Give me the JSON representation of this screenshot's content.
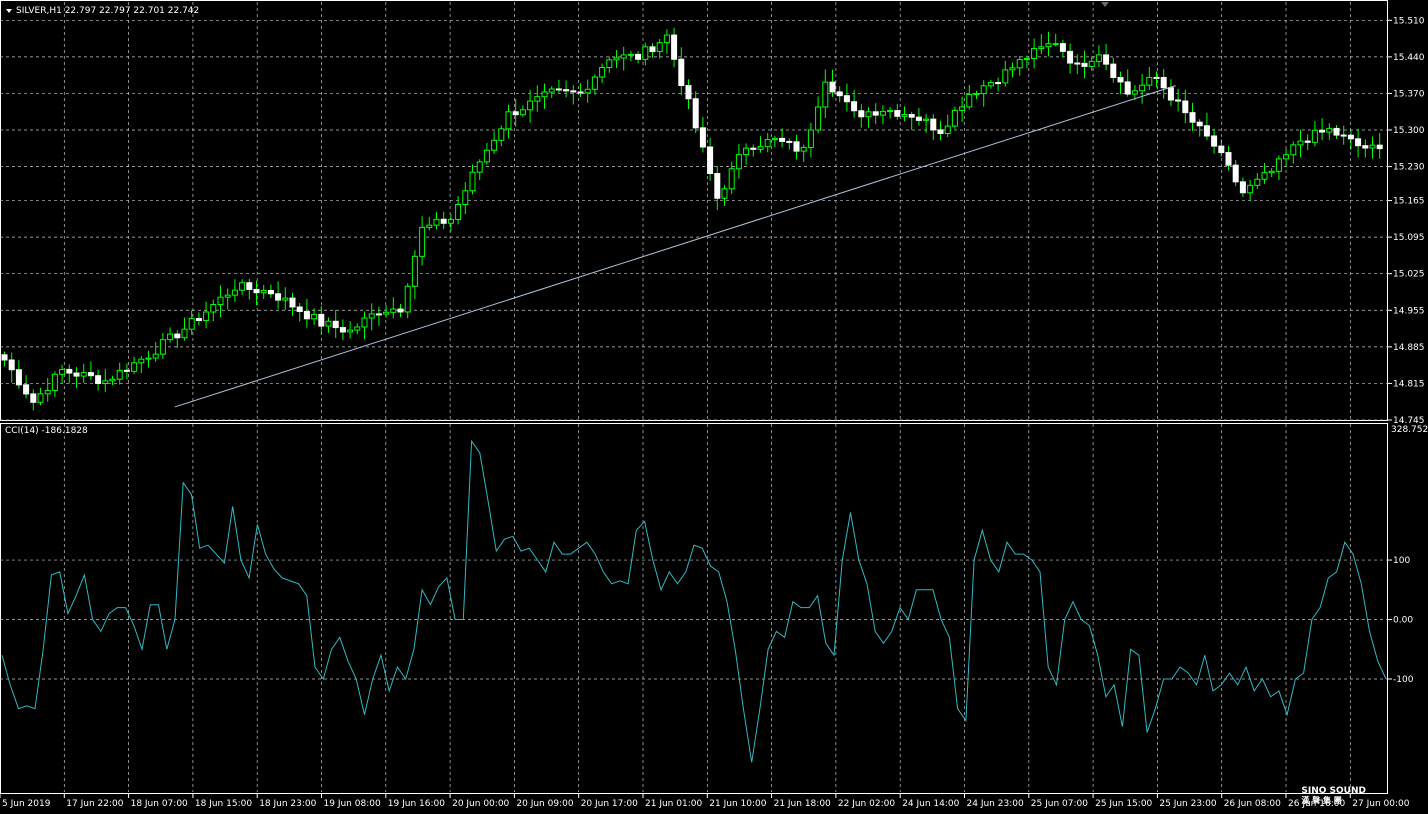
{
  "colors": {
    "background": "#000000",
    "grid": "#c8c8c8",
    "bull": "#00ff00",
    "bear": "#ffffff",
    "trendline": "#b0c4de",
    "cci_line": "#2fb9c4",
    "text": "#ffffff"
  },
  "price_panel": {
    "symbol_info": "SILVER,H1  22.797 22.797 22.701 22.742"
  },
  "indicator_panel": {
    "info": "CCI(14) -186.1828",
    "top_label": "328.7524"
  },
  "logo": {
    "line1": "SINO SOUND",
    "line2": "漢 聲 集 團"
  },
  "chart_data": [
    {
      "type": "candlestick",
      "title": "SILVER,H1",
      "y_ticks": [
        "15.510",
        "15.440",
        "15.370",
        "15.300",
        "15.230",
        "15.165",
        "15.095",
        "15.025",
        "14.955",
        "14.885",
        "14.815",
        "14.745"
      ],
      "ylim": [
        14.745,
        15.545
      ],
      "x_tick_labels": [
        "5 Jun 2019",
        "17 Jun 22:00",
        "18 Jun 07:00",
        "18 Jun 15:00",
        "18 Jun 23:00",
        "19 Jun 08:00",
        "19 Jun 16:00",
        "20 Jun 00:00",
        "20 Jun 09:00",
        "20 Jun 17:00",
        "21 Jun 01:00",
        "21 Jun 10:00",
        "21 Jun 18:00",
        "22 Jun 02:00",
        "24 Jun 14:00",
        "24 Jun 23:00",
        "25 Jun 07:00",
        "25 Jun 15:00",
        "25 Jun 23:00",
        "26 Jun 08:00",
        "26 Jun 16:00",
        "27 Jun 00:00"
      ],
      "close_anchors": [
        [
          0,
          14.86
        ],
        [
          4,
          14.78
        ],
        [
          8,
          14.84
        ],
        [
          14,
          14.82
        ],
        [
          20,
          14.87
        ],
        [
          26,
          14.93
        ],
        [
          32,
          15.0
        ],
        [
          37,
          14.99
        ],
        [
          44,
          14.93
        ],
        [
          48,
          14.915
        ],
        [
          52,
          14.955
        ],
        [
          55,
          14.96
        ],
        [
          58,
          15.11
        ],
        [
          62,
          15.13
        ],
        [
          66,
          15.24
        ],
        [
          70,
          15.33
        ],
        [
          76,
          15.37
        ],
        [
          80,
          15.37
        ],
        [
          84,
          15.44
        ],
        [
          88,
          15.44
        ],
        [
          92,
          15.48
        ],
        [
          95,
          15.35
        ],
        [
          99,
          15.17
        ],
        [
          103,
          15.27
        ],
        [
          107,
          15.28
        ],
        [
          111,
          15.26
        ],
        [
          114,
          15.4
        ],
        [
          118,
          15.33
        ],
        [
          122,
          15.34
        ],
        [
          126,
          15.33
        ],
        [
          130,
          15.3
        ],
        [
          134,
          15.37
        ],
        [
          138,
          15.4
        ],
        [
          142,
          15.44
        ],
        [
          146,
          15.47
        ],
        [
          149,
          15.42
        ],
        [
          152,
          15.45
        ],
        [
          156,
          15.37
        ],
        [
          160,
          15.4
        ],
        [
          164,
          15.33
        ],
        [
          168,
          15.27
        ],
        [
          172,
          15.18
        ],
        [
          176,
          15.22
        ],
        [
          180,
          15.28
        ],
        [
          184,
          15.3
        ],
        [
          188,
          15.27
        ],
        [
          191,
          15.26
        ]
      ],
      "trendline": {
        "from": [
          24,
          14.77
        ],
        "to": [
          163,
          15.385
        ]
      }
    },
    {
      "type": "line",
      "title": "CCI(14)",
      "y_ticks": [
        "100",
        "0.00",
        "-100"
      ],
      "ylim": [
        -290,
        328.7524
      ],
      "values": [
        -60,
        -110,
        -150,
        -145,
        -150,
        -50,
        75,
        80,
        10,
        40,
        75,
        0,
        -20,
        10,
        20,
        20,
        -10,
        -50,
        25,
        25,
        -50,
        0,
        230,
        210,
        120,
        125,
        110,
        95,
        190,
        100,
        70,
        160,
        110,
        85,
        70,
        65,
        60,
        40,
        -80,
        -100,
        -50,
        -30,
        -70,
        -100,
        -160,
        -100,
        -60,
        -120,
        -80,
        -100,
        -50,
        50,
        25,
        55,
        70,
        0,
        0,
        300,
        280,
        200,
        115,
        135,
        140,
        115,
        120,
        100,
        80,
        130,
        110,
        110,
        120,
        130,
        110,
        80,
        60,
        65,
        60,
        150,
        165,
        100,
        50,
        80,
        60,
        80,
        125,
        120,
        90,
        80,
        30,
        -50,
        -150,
        -240,
        -150,
        -50,
        -20,
        -30,
        30,
        20,
        20,
        40,
        -40,
        -60,
        100,
        180,
        100,
        60,
        -20,
        -40,
        -20,
        20,
        0,
        50,
        50,
        50,
        0,
        -30,
        -150,
        -170,
        100,
        150,
        100,
        80,
        130,
        110,
        110,
        100,
        80,
        -80,
        -110,
        0,
        30,
        0,
        -10,
        -60,
        -130,
        -110,
        -180,
        -50,
        -60,
        -190,
        -150,
        -100,
        -100,
        -80,
        -90,
        -110,
        -60,
        -120,
        -110,
        -90,
        -110,
        -80,
        -120,
        -100,
        -130,
        -120,
        -160,
        -100,
        -90,
        0,
        20,
        70,
        80,
        130,
        110,
        60,
        -20,
        -70,
        -100
      ]
    }
  ]
}
